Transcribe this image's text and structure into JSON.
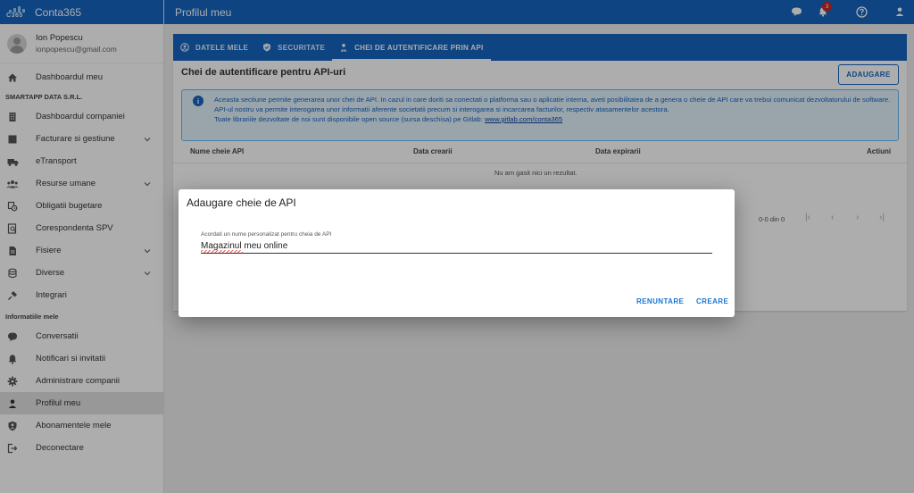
{
  "app": {
    "name": "Conta365",
    "logo_text": "C365"
  },
  "user": {
    "name": "Ion Popescu",
    "email": "ionpopescu@gmail.com"
  },
  "sidebar": {
    "items": [
      {
        "label": "Dashboardul meu",
        "icon": "home-icon"
      },
      {
        "label": "Dashboardul companiei",
        "icon": "building-icon"
      },
      {
        "label": "Facturare si gestiune",
        "icon": "invoice-icon"
      },
      {
        "label": "eTransport",
        "icon": "truck-icon"
      },
      {
        "label": "Resurse umane",
        "icon": "people-icon"
      },
      {
        "label": "Obligatii bugetare",
        "icon": "budget-icon"
      },
      {
        "label": "Corespondenta SPV",
        "icon": "mail-search-icon"
      },
      {
        "label": "Fisiere",
        "icon": "file-icon"
      },
      {
        "label": "Diverse",
        "icon": "database-icon"
      },
      {
        "label": "Integrari",
        "icon": "plug-icon"
      },
      {
        "label": "Conversatii",
        "icon": "chat-icon"
      },
      {
        "label": "Notificari si invitatii",
        "icon": "bell-icon"
      },
      {
        "label": "Administrare companii",
        "icon": "gear-icon"
      },
      {
        "label": "Profilul meu",
        "icon": "person-icon"
      },
      {
        "label": "Abonamentele mele",
        "icon": "shield-person-icon"
      },
      {
        "label": "Deconectare",
        "icon": "logout-icon"
      }
    ],
    "sections": {
      "company": "SMARTAPP DATA S.R.L.",
      "info": "Informatiile mele"
    }
  },
  "topbar": {
    "title": "Profilul meu",
    "notification_count": "3"
  },
  "tabs": [
    {
      "label": "DATELE MELE"
    },
    {
      "label": "SECURITATE"
    },
    {
      "label": "CHEI DE AUTENTIFICARE PRIN API"
    }
  ],
  "main": {
    "heading": "Chei de autentificare pentru API-uri",
    "add_button": "ADAUGARE",
    "info": {
      "line1": "Aceasta sectiune permite generarea unor chei de API. In cazul in care doriti sa conectati o platforma sau o aplicatie interna, aveti posibilitatea de a genera o cheie de API care va trebui comunicat dezvoltatorului de software.",
      "line2": "API-ul nostru va permite interogarea unor informatii aferente societatii precum si interogarea si incarcarea facturilor, respectiv atasamentelor acestora.",
      "line3_prefix": "Toate librariile dezvoltate de noi sunt disponibile open source (sursa deschisa) pe Gitlab: ",
      "link": "www.gitlab.com/conta365"
    },
    "table": {
      "columns": [
        "Nume cheie API",
        "Data crearii",
        "Data expirarii",
        "Actiuni"
      ],
      "empty": "Nu am gasit nici un rezultat.",
      "pagination": "0-0 din 0"
    }
  },
  "dialog": {
    "title": "Adaugare cheie de API",
    "field_label": "Acordati un nume personalizat pentru cheia de API",
    "field_value": "Magazinul meu online",
    "cancel": "RENUNTARE",
    "create": "CREARE"
  },
  "colors": {
    "primary": "#1565c0",
    "info_bg": "#e3f2fd",
    "badge": "#c62828"
  }
}
